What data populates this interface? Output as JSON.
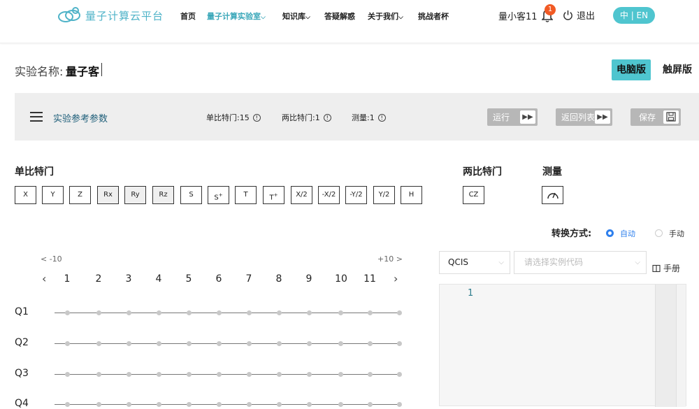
{
  "header": {
    "brand": "量子计算云平台",
    "nav": [
      {
        "label": "首页",
        "dropdown": false,
        "active": false
      },
      {
        "label": "量子计算实验室",
        "dropdown": true,
        "active": true
      },
      {
        "label": "知识库",
        "dropdown": true,
        "active": false
      },
      {
        "label": "答疑解惑",
        "dropdown": false,
        "active": false
      },
      {
        "label": "关于我们",
        "dropdown": true,
        "active": false
      },
      {
        "label": "挑战者杯",
        "dropdown": false,
        "active": false
      }
    ],
    "user_name": "量小客11",
    "notification_count": "1",
    "logout_label": "退出",
    "lang_toggle": "中 | EN"
  },
  "experiment": {
    "name_label": "实验名称:",
    "name_value": "量子客",
    "view_pc": "电脑版",
    "view_touch": "触屏版"
  },
  "params": {
    "title": "实验参考参数",
    "single_gate_stat": "单比特门:15",
    "two_gate_stat": "两比特门:1",
    "measure_stat": "测量:1",
    "run": "运行",
    "back_list": "返回列表",
    "save": "保存"
  },
  "gates": {
    "single_title": "单比特门",
    "single": [
      "X",
      "Y",
      "Z",
      "Rx",
      "Ry",
      "Rz",
      "S",
      "S",
      "T",
      "T",
      "X/2",
      "-X/2",
      "-Y/2",
      "Y/2",
      "H"
    ],
    "two_title": "两比特门",
    "two": [
      "CZ"
    ],
    "measure_title": "测量"
  },
  "convert": {
    "label": "转换方式:",
    "auto": "自动",
    "manual": "手动"
  },
  "circuit": {
    "prev_page": "< -10",
    "next_page": "+10 >",
    "columns": [
      "1",
      "2",
      "3",
      "4",
      "5",
      "6",
      "7",
      "8",
      "9",
      "10",
      "11"
    ],
    "qubits": [
      "Q1",
      "Q2",
      "Q3",
      "Q4"
    ]
  },
  "code": {
    "language": "QCIS",
    "example_placeholder": "请选择实例代码",
    "manual_label": "手册",
    "line_numbers": [
      "1"
    ]
  },
  "colors": {
    "accent": "#4fc5cf",
    "brand": "#4fb3c8",
    "badge": "#f15a24",
    "radio": "#2f80ed"
  }
}
